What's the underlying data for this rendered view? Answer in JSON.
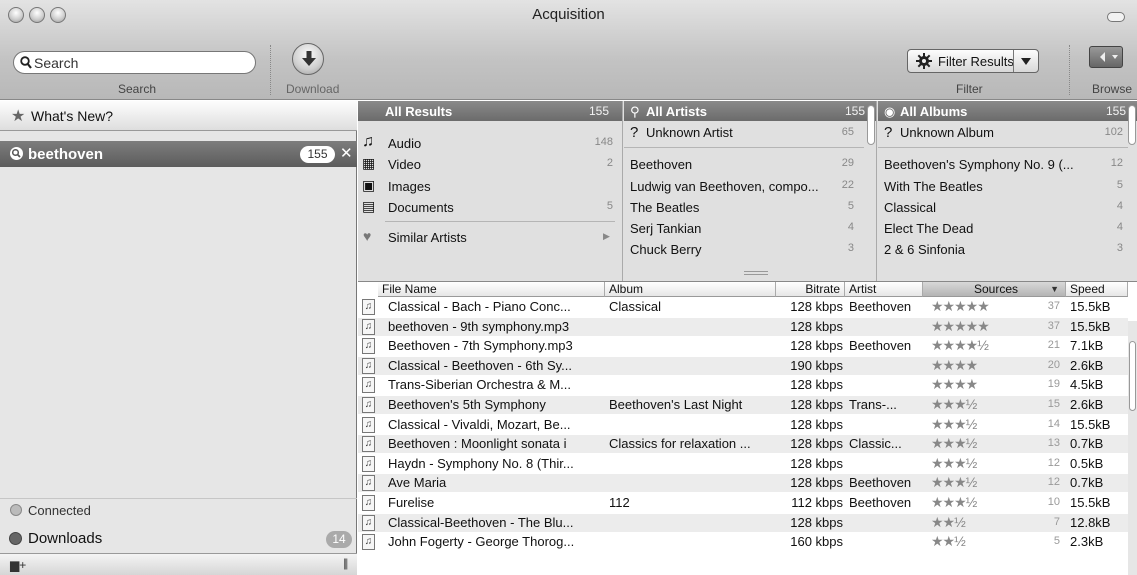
{
  "window": {
    "title": "Acquisition"
  },
  "toolbar": {
    "search_placeholder": "Search",
    "search_label": "Search",
    "download_label": "Download",
    "filter_button": "Filter Results",
    "filter_label": "Filter",
    "browse_label": "Browse"
  },
  "sidebar": {
    "whats_new": "What's New?",
    "search_item": {
      "label": "beethoven",
      "count": "155"
    },
    "connected": "Connected",
    "downloads": {
      "label": "Downloads",
      "count": "14"
    }
  },
  "browser": {
    "types": {
      "header": "All Results",
      "count": "155",
      "items": [
        {
          "label": "Audio",
          "count": "148",
          "icon": "audio-icon"
        },
        {
          "label": "Video",
          "count": "2",
          "icon": "video-icon"
        },
        {
          "label": "Images",
          "count": "",
          "icon": "images-icon"
        },
        {
          "label": "Documents",
          "count": "5",
          "icon": "documents-icon"
        }
      ],
      "similar": "Similar Artists"
    },
    "artists": {
      "header": "All Artists",
      "count": "155",
      "unknown": {
        "label": "Unknown Artist",
        "count": "65"
      },
      "items": [
        {
          "label": "Beethoven",
          "count": "29"
        },
        {
          "label": "Ludwig van Beethoven, compo...",
          "count": "22"
        },
        {
          "label": "The Beatles",
          "count": "5"
        },
        {
          "label": "Serj Tankian",
          "count": "4"
        },
        {
          "label": "Chuck Berry",
          "count": "3"
        }
      ]
    },
    "albums": {
      "header": "All Albums",
      "count": "155",
      "unknown": {
        "label": "Unknown Album",
        "count": "102"
      },
      "items": [
        {
          "label": "Beethoven's Symphony No. 9 (...",
          "count": "12"
        },
        {
          "label": "With The Beatles",
          "count": "5"
        },
        {
          "label": "Classical",
          "count": "4"
        },
        {
          "label": "Elect The Dead",
          "count": "4"
        },
        {
          "label": "2 & 6 Sinfonia",
          "count": "3"
        }
      ]
    }
  },
  "table": {
    "columns": [
      "File Name",
      "Album",
      "Bitrate",
      "Artist",
      "Sources",
      "Speed"
    ],
    "sort_arrow": "▼",
    "rows": [
      {
        "file": "Classical - Bach - Piano Conc...",
        "album": "Classical",
        "bitrate": "128 kbps",
        "artist": "Beethoven",
        "stars": "★★★★★",
        "sources": "37",
        "speed": "15.5kB"
      },
      {
        "file": "beethoven - 9th symphony.mp3",
        "album": "",
        "bitrate": "128 kbps",
        "artist": "",
        "stars": "★★★★★",
        "sources": "37",
        "speed": "15.5kB"
      },
      {
        "file": "Beethoven - 7th Symphony.mp3",
        "album": "",
        "bitrate": "128 kbps",
        "artist": "Beethoven",
        "stars": "★★★★½",
        "sources": "21",
        "speed": "7.1kB"
      },
      {
        "file": "Classical - Beethoven - 6th Sy...",
        "album": "",
        "bitrate": "190 kbps",
        "artist": "",
        "stars": "★★★★",
        "sources": "20",
        "speed": "2.6kB"
      },
      {
        "file": "Trans-Siberian Orchestra & M...",
        "album": "",
        "bitrate": "128 kbps",
        "artist": "",
        "stars": "★★★★",
        "sources": "19",
        "speed": "4.5kB"
      },
      {
        "file": "Beethoven's 5th Symphony",
        "album": "Beethoven's Last Night",
        "bitrate": "128 kbps",
        "artist": "Trans-...",
        "stars": "★★★½",
        "sources": "15",
        "speed": "2.6kB"
      },
      {
        "file": "Classical - Vivaldi, Mozart, Be...",
        "album": "",
        "bitrate": "128 kbps",
        "artist": "",
        "stars": "★★★½",
        "sources": "14",
        "speed": "15.5kB"
      },
      {
        "file": "Beethoven : Moonlight sonata i",
        "album": "Classics for relaxation ...",
        "bitrate": "128 kbps",
        "artist": "Classic...",
        "stars": "★★★½",
        "sources": "13",
        "speed": "0.7kB"
      },
      {
        "file": "Haydn - Symphony No. 8 (Thir...",
        "album": "",
        "bitrate": "128 kbps",
        "artist": "",
        "stars": "★★★½",
        "sources": "12",
        "speed": "0.5kB"
      },
      {
        "file": "Ave Maria",
        "album": "",
        "bitrate": "128 kbps",
        "artist": "Beethoven",
        "stars": "★★★½",
        "sources": "12",
        "speed": "0.7kB"
      },
      {
        "file": "Furelise",
        "album": "112",
        "bitrate": "112 kbps",
        "artist": "Beethoven",
        "stars": "★★★½",
        "sources": "10",
        "speed": "15.5kB"
      },
      {
        "file": "Classical-Beethoven - The Blu...",
        "album": "",
        "bitrate": "128 kbps",
        "artist": "",
        "stars": "★★½",
        "sources": "7",
        "speed": "12.8kB"
      },
      {
        "file": "John Fogerty - George Thorog...",
        "album": "",
        "bitrate": "160 kbps",
        "artist": "",
        "stars": "★★½",
        "sources": "5",
        "speed": "2.3kB"
      }
    ]
  }
}
